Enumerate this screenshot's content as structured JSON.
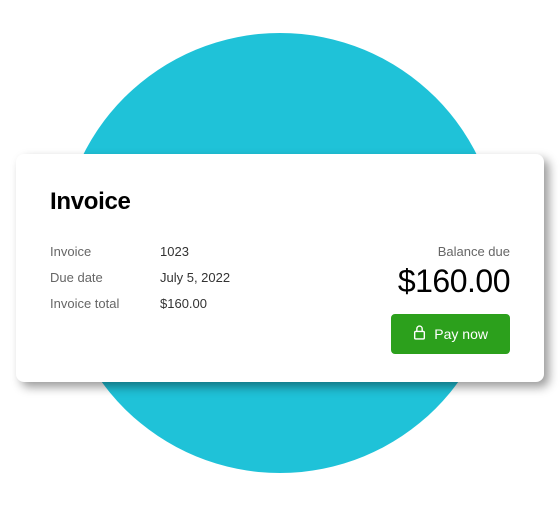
{
  "title": "Invoice",
  "details": {
    "invoice_label": "Invoice",
    "invoice_value": "1023",
    "due_date_label": "Due date",
    "due_date_value": "July 5, 2022",
    "invoice_total_label": "Invoice total",
    "invoice_total_value": "$160.00"
  },
  "balance": {
    "label": "Balance due",
    "amount": "$160.00"
  },
  "pay_button_label": "Pay now"
}
